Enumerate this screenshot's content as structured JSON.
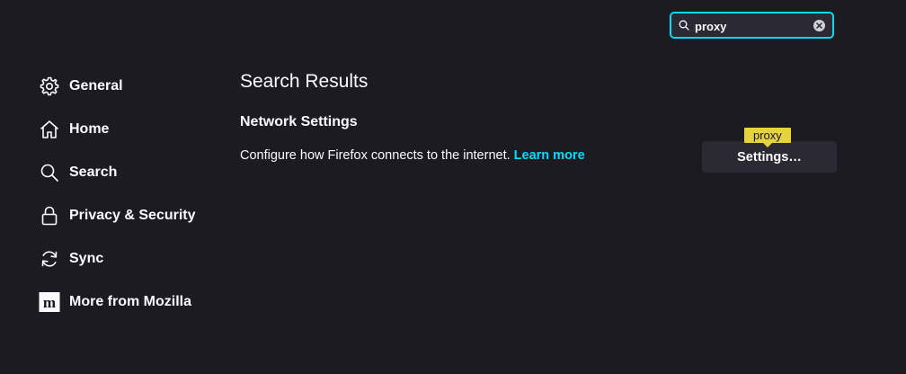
{
  "search": {
    "value": "proxy",
    "placeholder": ""
  },
  "sidebar": {
    "items": [
      {
        "label": "General",
        "icon": "gear-icon"
      },
      {
        "label": "Home",
        "icon": "home-icon"
      },
      {
        "label": "Search",
        "icon": "search-icon"
      },
      {
        "label": "Privacy & Security",
        "icon": "lock-icon"
      },
      {
        "label": "Sync",
        "icon": "sync-icon"
      },
      {
        "label": "More from Mozilla",
        "icon": "mozilla-icon"
      }
    ]
  },
  "main": {
    "title": "Search Results",
    "section_title": "Network Settings",
    "description": "Configure how Firefox connects to the internet.",
    "learn_more": "Learn more",
    "settings_button": "Settings…",
    "highlight_tag": "proxy"
  },
  "colors": {
    "background": "#1c1b22",
    "accent": "#00ddff",
    "highlight": "#e5d23d",
    "button_bg": "#2b2a33"
  }
}
